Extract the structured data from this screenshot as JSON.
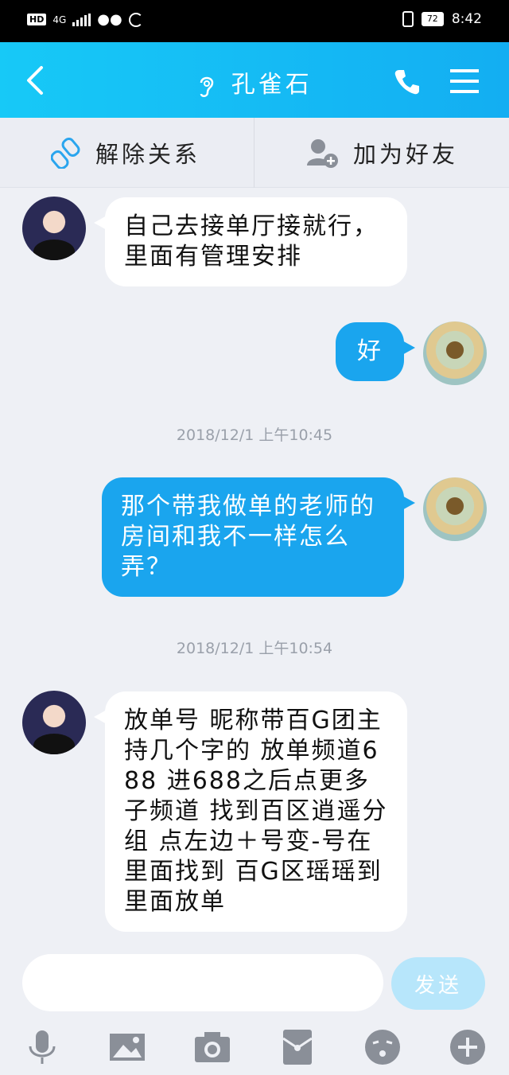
{
  "status_bar": {
    "hd": "HD",
    "network": "4G",
    "battery": "72",
    "time": "8:42"
  },
  "header": {
    "title": "孔雀石"
  },
  "actions": {
    "unbind_label": "解除关系",
    "add_friend_label": "加为好友"
  },
  "messages": [
    {
      "side": "in",
      "text": "自己去接单厅接就行，里面有管理安排"
    },
    {
      "side": "out",
      "text": "好"
    },
    {
      "timestamp": "2018/12/1 上午10:45"
    },
    {
      "side": "out",
      "text": "那个带我做单的老师的房间和我不一样怎么弄？"
    },
    {
      "timestamp": "2018/12/1 上午10:54"
    },
    {
      "side": "in",
      "text": "放单号 昵称带百G团主持几个字的 放单频道688  进688之后点更多子频道 找到百区逍遥分组 点左边＋号变-号在里面找到 百G区瑶瑶到里面放单"
    }
  ],
  "composer": {
    "input_value": "",
    "send_label": "发送"
  },
  "colors": {
    "accent": "#13aef2",
    "outgoing_bubble": "#1aa5ee",
    "send_disabled": "#b7e6fb"
  }
}
